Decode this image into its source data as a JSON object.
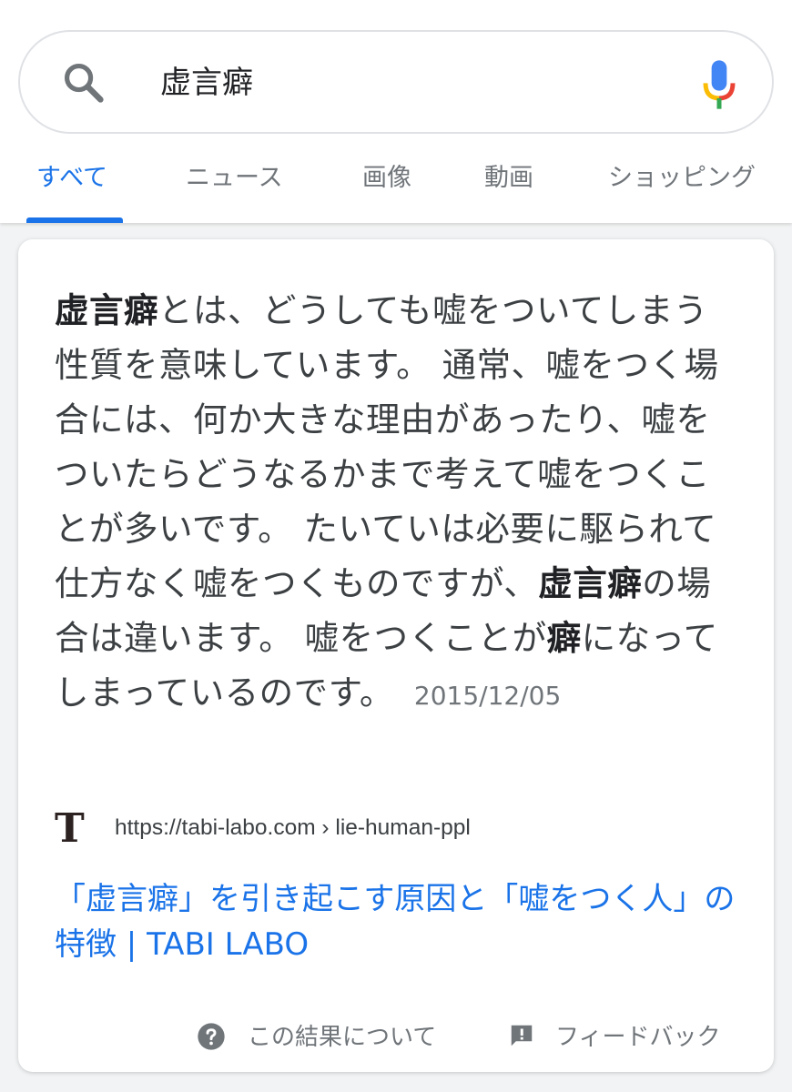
{
  "search": {
    "query": "虚言癖",
    "search_icon": "search-icon",
    "mic_icon": "mic-icon"
  },
  "tabs": [
    {
      "label": "すべて",
      "active": true
    },
    {
      "label": "ニュース",
      "active": false
    },
    {
      "label": "画像",
      "active": false
    },
    {
      "label": "動画",
      "active": false
    },
    {
      "label": "ショッピング",
      "active": false
    }
  ],
  "snippet": {
    "parts": [
      {
        "text": "虚言癖",
        "bold": true
      },
      {
        "text": "とは、どうしても嘘をついてしまう性質を意味しています。 通常、嘘をつく場合には、何か大きな理由があったり、嘘をついたらどうなるかまで考えて嘘をつくことが多いです。 たいていは必要に駆られて仕方なく嘘をつくものですが、",
        "bold": false
      },
      {
        "text": "虚言癖",
        "bold": true
      },
      {
        "text": "の場合は違います。 嘘をつくことが",
        "bold": false
      },
      {
        "text": "癖",
        "bold": true
      },
      {
        "text": "になってしまっているのです。",
        "bold": false
      }
    ],
    "date": "2015/12/05"
  },
  "source": {
    "logo_letter": "T",
    "url": "https://tabi-labo.com › lie-human-ppl"
  },
  "result": {
    "title": "「虚言癖」を引き起こす原因と「嘘をつく人」の特徴 | TABI LABO"
  },
  "footer": {
    "about_label": "この結果について",
    "feedback_label": "フィードバック",
    "help_icon": "help-circle-icon",
    "feedback_icon": "feedback-icon"
  },
  "colors": {
    "accent": "#1a73e8",
    "text": "#3c4043",
    "muted": "#70757a"
  }
}
